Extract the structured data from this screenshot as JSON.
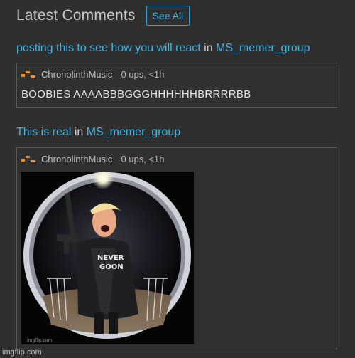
{
  "header": {
    "title": "Latest Comments",
    "see_all_label": "See All"
  },
  "comments": [
    {
      "post_title": "posting this to see how you will react",
      "in_label": "in",
      "group": "MS_memer_group",
      "user": "ChronolinthMusic",
      "stats": "0 ups, <1h",
      "text": "BOOBIES AAAABBBGGGHHHHHHBRRRRBB"
    },
    {
      "post_title": "This is real",
      "in_label": "in",
      "group": "MS_memer_group",
      "user": "ChronolinthMusic",
      "stats": "0 ups, <1h",
      "image": {
        "shirt_line1": "NEVER",
        "shirt_line2": "GOON",
        "watermark": "imgflip.com"
      }
    }
  ],
  "footer": {
    "watermark": "imgflip.com"
  },
  "colors": {
    "background": "#2f2f2f",
    "link": "#3fb6e6",
    "logo": "#f08a24"
  },
  "icons": [
    "imgflip-logo-icon"
  ]
}
